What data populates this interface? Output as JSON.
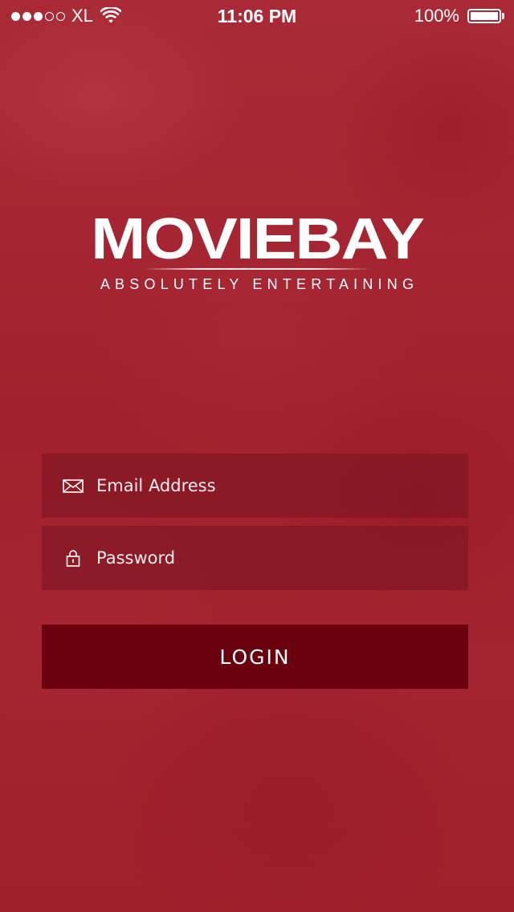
{
  "status_bar": {
    "signal_bars_filled": 3,
    "signal_bars_total": 5,
    "carrier": "XL",
    "wifi_icon": "wifi-icon",
    "time": "11:06 PM",
    "battery_percent_text": "100%",
    "battery_level": 1.0
  },
  "logo": {
    "title": "MOVIEBAY",
    "tagline": "ABSOLUTELY ENTERTAINING"
  },
  "form": {
    "email": {
      "placeholder": "Email Address",
      "value": "",
      "icon": "envelope-icon"
    },
    "password": {
      "placeholder": "Password",
      "value": "",
      "icon": "lock-icon"
    },
    "login_label": "LOGIN"
  },
  "colors": {
    "background": "#a4222f",
    "field_background": "#7f1a26",
    "login_button": "#6a000e",
    "text": "#ffffff"
  }
}
